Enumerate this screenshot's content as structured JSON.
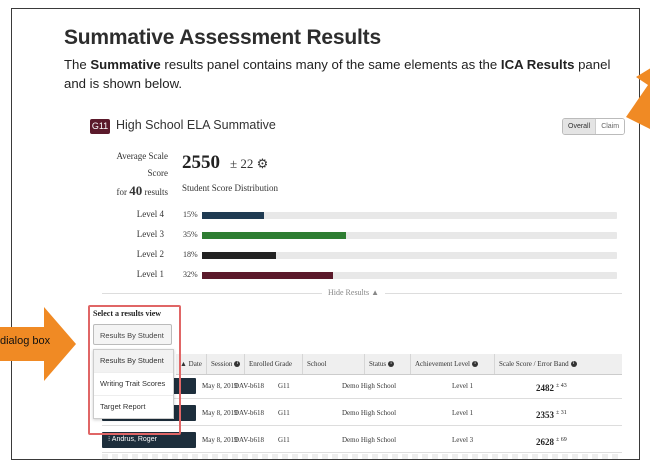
{
  "doc": {
    "title": "Summative Assessment Results",
    "intro_pre": "The ",
    "intro_b1": "Summative",
    "intro_mid": " results panel contains many of the same elements as the ",
    "intro_b2": "ICA Results",
    "intro_post": " panel and is shown below."
  },
  "panel": {
    "badge": "G11",
    "title": "High School ELA Summative",
    "toggle": {
      "overall": "Overall",
      "claim": "Claim"
    },
    "avg_label": "Average Scale Score",
    "for_label": "for",
    "results_count": "40",
    "results_label": "results",
    "score": "2550",
    "error": "± 22",
    "dist_title": "Student Score Distribution",
    "levels": [
      {
        "label": "Level 4",
        "pct": "15%",
        "value": 15,
        "color": "#1f3b52"
      },
      {
        "label": "Level 3",
        "pct": "35%",
        "value": 35,
        "color": "#2e7d32"
      },
      {
        "label": "Level 2",
        "pct": "18%",
        "value": 18,
        "color": "#222222"
      },
      {
        "label": "Level 1",
        "pct": "32%",
        "value": 32,
        "color": "#5b1a2b"
      }
    ],
    "hide_results": "Hide Results ▲"
  },
  "results_view": {
    "title": "Select a results view",
    "selected": "Results By Student ⌄",
    "options": [
      "Results By Student",
      "Writing Trait Scores",
      "Target Report"
    ]
  },
  "annotation": {
    "label": "dialog box",
    "accent": "#f08a24"
  },
  "table": {
    "headers": {
      "date": "▲ Date",
      "session": "Session",
      "grade": "Enrolled Grade",
      "school": "School",
      "status": "Status",
      "level": "Achievement Level",
      "score": "Scale Score / Error Band"
    },
    "rows": [
      {
        "student": "",
        "date": "May 8, 2019",
        "session": "DAV-b618",
        "grade": "G11",
        "school": "Demo High School",
        "level": "Level 1",
        "score": "2482",
        "err": "± 43"
      },
      {
        "student": "",
        "date": "May 8, 2019",
        "session": "DAV-b618",
        "grade": "G11",
        "school": "Demo High School",
        "level": "Level 1",
        "score": "2353",
        "err": "± 31"
      },
      {
        "student": "⁝ Andrus, Roger",
        "date": "May 8, 2019",
        "session": "DAV-b618",
        "grade": "G11",
        "school": "Demo High School",
        "level": "Level 3",
        "score": "2628",
        "err": "± 69"
      }
    ]
  }
}
